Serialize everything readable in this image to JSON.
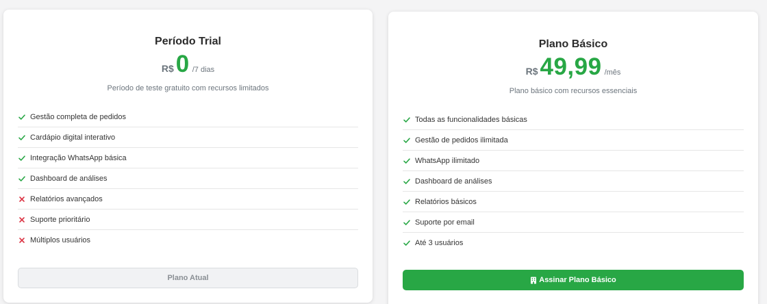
{
  "plans": [
    {
      "name": "Período Trial",
      "currency": "R$",
      "amount": "0",
      "period": "/7 dias",
      "description": "Período de teste gratuito com recursos limitados",
      "features": [
        {
          "label": "Gestão completa de pedidos",
          "included": true,
          "icon": "check-icon"
        },
        {
          "label": "Cardápio digital interativo",
          "included": true,
          "icon": "check-icon"
        },
        {
          "label": "Integração WhatsApp básica",
          "included": true,
          "icon": "check-icon"
        },
        {
          "label": "Dashboard de análises",
          "included": true,
          "icon": "check-icon"
        },
        {
          "label": "Relatórios avançados",
          "included": false,
          "icon": "x-icon"
        },
        {
          "label": "Suporte prioritário",
          "included": false,
          "icon": "x-icon"
        },
        {
          "label": "Múltiplos usuários",
          "included": false,
          "icon": "x-icon"
        }
      ],
      "button_label": "Plano Atual"
    },
    {
      "name": "Plano Básico",
      "currency": "R$",
      "amount": "49,99",
      "period": "/mês",
      "description": "Plano básico com recursos essenciais",
      "features": [
        {
          "label": "Todas as funcionalidades básicas",
          "included": true,
          "icon": "check-icon"
        },
        {
          "label": "Gestão de pedidos ilimitada",
          "included": true,
          "icon": "check-icon"
        },
        {
          "label": "WhatsApp ilimitado",
          "included": true,
          "icon": "check-icon"
        },
        {
          "label": "Dashboard de análises",
          "included": true,
          "icon": "check-icon"
        },
        {
          "label": "Relatórios básicos",
          "included": true,
          "icon": "check-icon"
        },
        {
          "label": "Suporte por email",
          "included": true,
          "icon": "check-icon"
        },
        {
          "label": "Até 3 usuários",
          "included": true,
          "icon": "check-icon"
        }
      ],
      "button_label": "Assinar Plano Básico",
      "button_icon": "building-icon"
    }
  ],
  "colors": {
    "accent": "#28a745",
    "check": "#28a745",
    "cross": "#dc3545",
    "muted": "#6c757d"
  }
}
